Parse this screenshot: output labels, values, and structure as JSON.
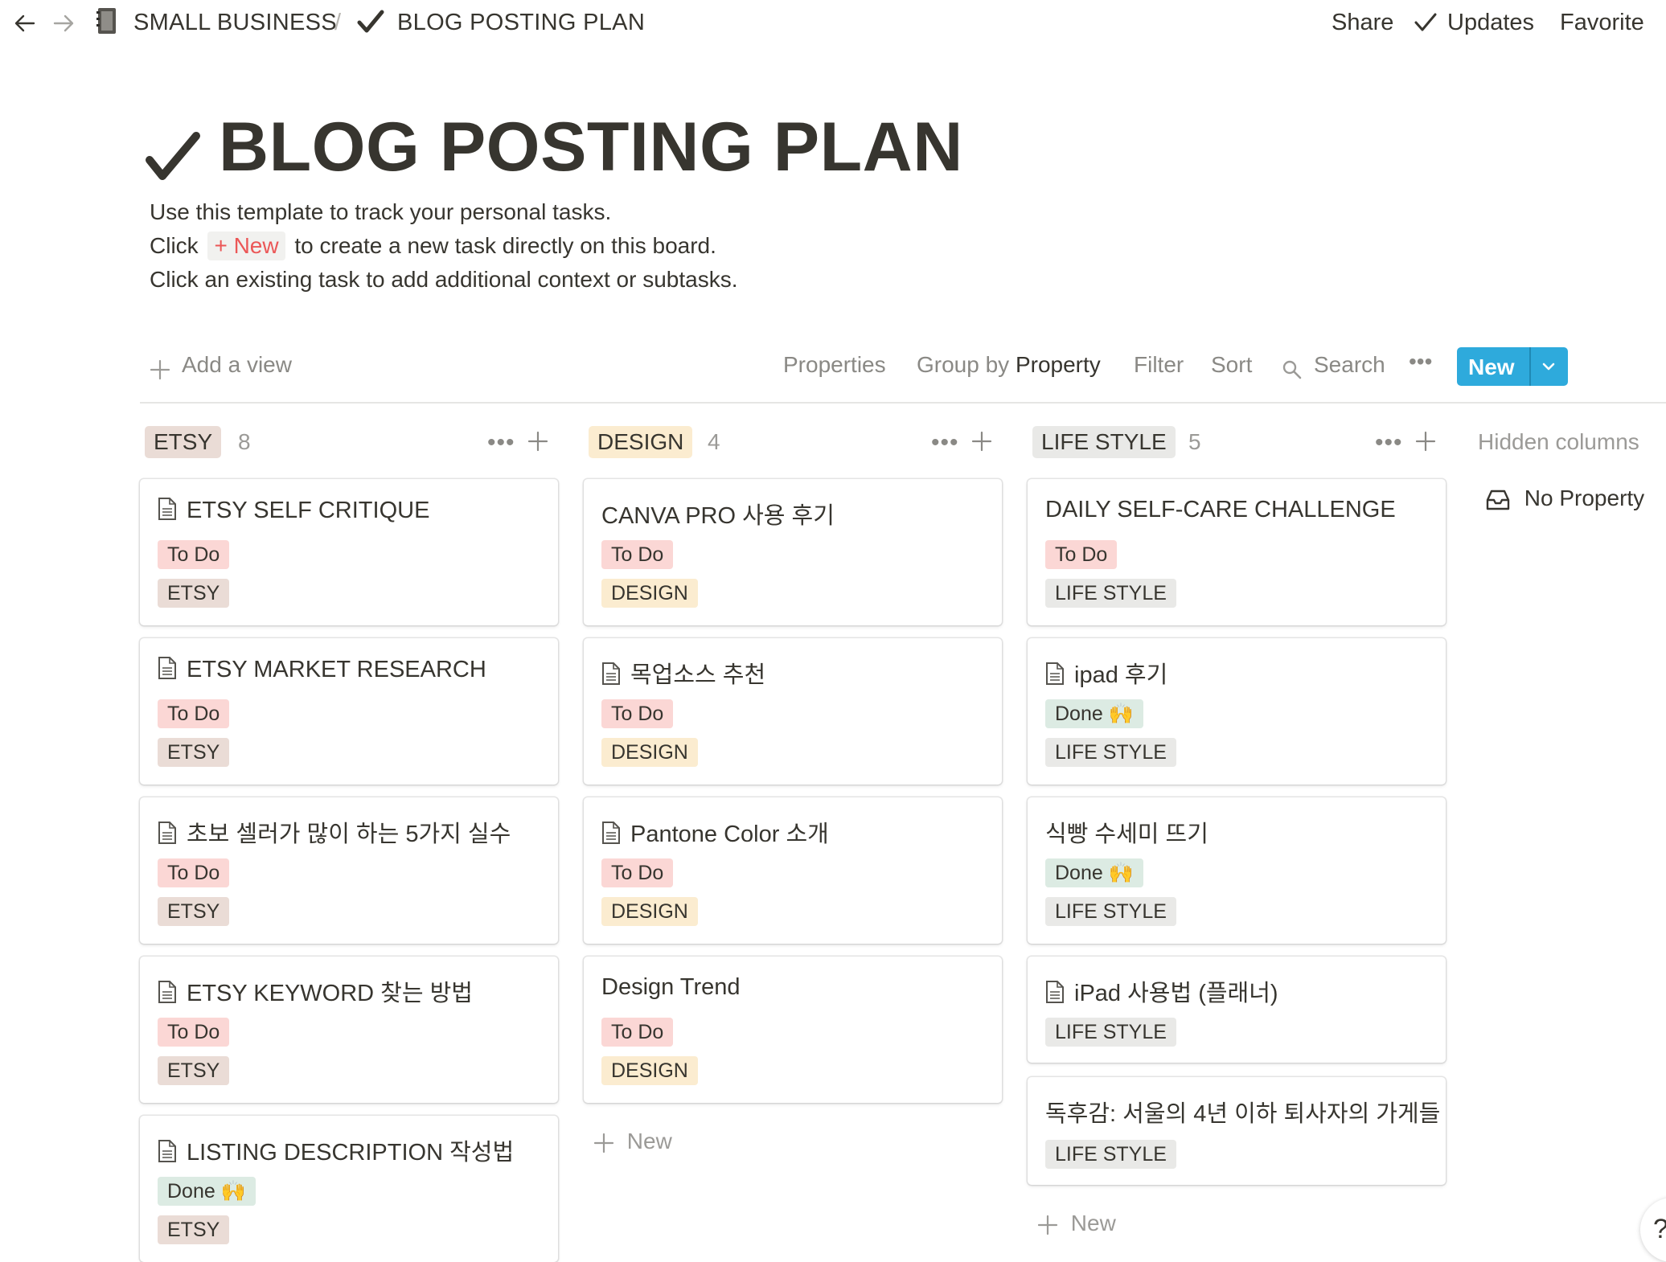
{
  "topbar": {
    "breadcrumb_workspace": "SMALL BUSINESS",
    "breadcrumb_sep": "/",
    "breadcrumb_page": "BLOG POSTING PLAN",
    "share": "Share",
    "updates": "Updates",
    "favorite": "Favorite"
  },
  "page": {
    "title": "BLOG POSTING PLAN",
    "desc_line1": "Use this template to track your personal tasks.",
    "desc_line2_pre": "Click",
    "desc_line2_chip": "+ New",
    "desc_line2_post": "to create a new task directly on this board.",
    "desc_line3": "Click an existing task to add additional context or subtasks."
  },
  "toolbar": {
    "add_view": "Add a view",
    "properties": "Properties",
    "group_by": "Group by",
    "group_by_value": "Property",
    "filter": "Filter",
    "sort": "Sort",
    "search": "Search",
    "more": "•••",
    "new": "New"
  },
  "columns": [
    {
      "name": "ETSY",
      "count": "8",
      "cards": [
        {
          "title": "ETSY SELF CRITIQUE",
          "status": "To Do",
          "tag": "ETSY"
        },
        {
          "title": "ETSY MARKET RESEARCH",
          "status": "To Do",
          "tag": "ETSY"
        },
        {
          "title": "초보 셀러가 많이 하는 5가지 실수",
          "status": "To Do",
          "tag": "ETSY"
        },
        {
          "title": "ETSY KEYWORD 찾는 방법",
          "status": "To Do",
          "tag": "ETSY"
        },
        {
          "title": "LISTING DESCRIPTION 작성법",
          "status": "Done 🙌",
          "tag": "ETSY"
        }
      ]
    },
    {
      "name": "DESIGN",
      "count": "4",
      "cards": [
        {
          "title": "CANVA PRO 사용 후기",
          "status": "To Do",
          "tag": "DESIGN"
        },
        {
          "title": "목업소스 추천",
          "status": "To Do",
          "tag": "DESIGN"
        },
        {
          "title": "Pantone Color 소개",
          "status": "To Do",
          "tag": "DESIGN"
        },
        {
          "title": "Design Trend",
          "status": "To Do",
          "tag": "DESIGN"
        }
      ],
      "add_new": "New"
    },
    {
      "name": "LIFE STYLE",
      "count": "5",
      "cards": [
        {
          "title": "DAILY SELF-CARE CHALLENGE",
          "status": "To Do",
          "tag": "LIFE STYLE"
        },
        {
          "title": "ipad 후기",
          "status": "Done 🙌",
          "tag": "LIFE STYLE"
        },
        {
          "title": "식빵 수세미 뜨기",
          "status": "Done 🙌",
          "tag": "LIFE STYLE"
        },
        {
          "title": "iPad 사용법 (플래너)",
          "tag": "LIFE STYLE"
        },
        {
          "title": "독후감: 서울의 4년 이하 퇴사자의 가게들",
          "tag": "LIFE STYLE"
        }
      ],
      "add_new": "New"
    }
  ],
  "hidden_columns": {
    "label": "Hidden columns",
    "items": [
      "No Property"
    ]
  },
  "help": "?",
  "colors": {
    "accent": "#2eaadc",
    "todo_bg": "#fbd7d5",
    "done_bg": "#dcebe3",
    "etsy_bg": "#eadcd6",
    "design_bg": "#fbecd0",
    "lifestyle_bg": "#e9e9e7"
  }
}
